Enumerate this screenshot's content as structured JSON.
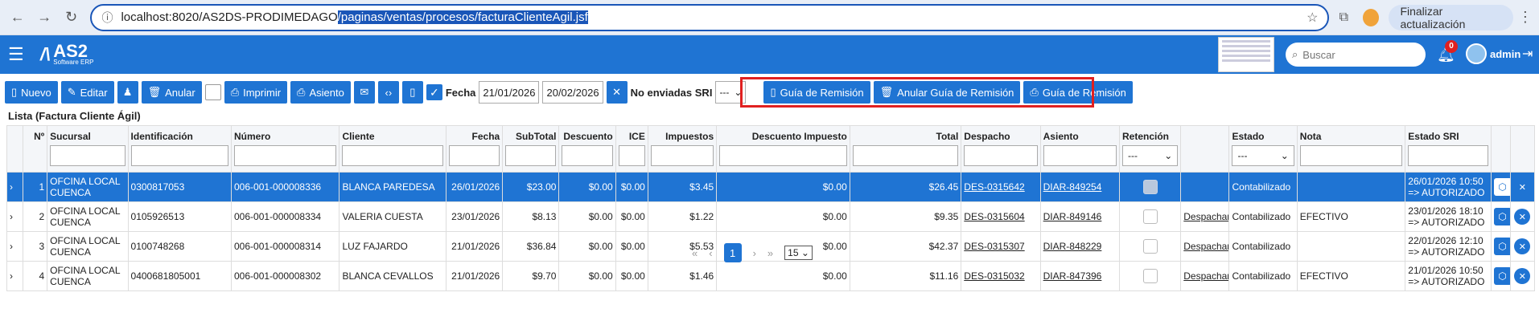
{
  "browser": {
    "url_prefix": "localhost:8020/AS2DS-PRODIMEDAGO",
    "url_selected": "/paginas/ventas/procesos/facturaClienteAgil.jsf",
    "update_label": "Finalizar actualización"
  },
  "header": {
    "logo_mark": "/\\",
    "logo_name": "AS2",
    "logo_sub": "Software ERP",
    "search_placeholder": "Buscar",
    "notif_count": "0",
    "user": "admin"
  },
  "toolbar": {
    "nuevo": "Nuevo",
    "editar": "Editar",
    "anular": "Anular",
    "imprimir": "Imprimir",
    "asiento": "Asiento",
    "fecha_label": "Fecha",
    "fecha_desde": "21/01/2026",
    "fecha_hasta": "20/02/2026",
    "no_enviadas_label": "No enviadas SRI",
    "no_enviadas_value": "---",
    "guia1": "Guía de Remisión",
    "anular_guia": "Anular Guía de Remisión",
    "guia2": "Guía de Remisión"
  },
  "list": {
    "title": "Lista (Factura Cliente Ágil)",
    "columns": [
      "Nº",
      "Sucursal",
      "Identificación",
      "Número",
      "Cliente",
      "Fecha",
      "SubTotal",
      "Descuento",
      "ICE",
      "Impuestos",
      "Descuento Impuesto",
      "Total",
      "Despacho",
      "Asiento",
      "Retención",
      "",
      "Estado",
      "Nota",
      "Estado SRI"
    ],
    "filter_select_value": "---",
    "despachar_label": "Despachar",
    "rows": [
      {
        "n": "1",
        "sucursal": "OFCINA LOCAL CUENCA",
        "id": "0300817053",
        "numero": "006-001-000008336",
        "cliente": "BLANCA PAREDESA",
        "fecha": "26/01/2026",
        "subtotal": "$23.00",
        "descuento": "$0.00",
        "ice": "$0.00",
        "impuestos": "$3.45",
        "desc_imp": "$0.00",
        "total": "$26.45",
        "despacho": "DES-0315642",
        "asiento": "DIAR-849254",
        "estado": "Contabilizado",
        "nota": "",
        "sri1": "26/01/2026 10:50",
        "sri2": "=> AUTORIZADO"
      },
      {
        "n": "2",
        "sucursal": "OFCINA LOCAL CUENCA",
        "id": "0105926513",
        "numero": "006-001-000008334",
        "cliente": "VALERIA CUESTA",
        "fecha": "23/01/2026",
        "subtotal": "$8.13",
        "descuento": "$0.00",
        "ice": "$0.00",
        "impuestos": "$1.22",
        "desc_imp": "$0.00",
        "total": "$9.35",
        "despacho": "DES-0315604",
        "asiento": "DIAR-849146",
        "estado": "Contabilizado",
        "nota": "EFECTIVO",
        "sri1": "23/01/2026 18:10",
        "sri2": "=> AUTORIZADO"
      },
      {
        "n": "3",
        "sucursal": "OFCINA LOCAL CUENCA",
        "id": "0100748268",
        "numero": "006-001-000008314",
        "cliente": "LUZ FAJARDO",
        "fecha": "21/01/2026",
        "subtotal": "$36.84",
        "descuento": "$0.00",
        "ice": "$0.00",
        "impuestos": "$5.53",
        "desc_imp": "$0.00",
        "total": "$42.37",
        "despacho": "DES-0315307",
        "asiento": "DIAR-848229",
        "estado": "Contabilizado",
        "nota": "",
        "sri1": "22/01/2026 12:10",
        "sri2": "=> AUTORIZADO"
      },
      {
        "n": "4",
        "sucursal": "OFCINA LOCAL CUENCA",
        "id": "0400681805001",
        "numero": "006-001-000008302",
        "cliente": "BLANCA CEVALLOS",
        "fecha": "21/01/2026",
        "subtotal": "$9.70",
        "descuento": "$0.00",
        "ice": "$0.00",
        "impuestos": "$1.46",
        "desc_imp": "$0.00",
        "total": "$11.16",
        "despacho": "DES-0315032",
        "asiento": "DIAR-847396",
        "estado": "Contabilizado",
        "nota": "EFECTIVO",
        "sri1": "21/01/2026 10:50",
        "sri2": "=> AUTORIZADO"
      }
    ]
  },
  "pager": {
    "first": "«",
    "prev": "‹",
    "current": "1",
    "next": "›",
    "last": "»",
    "page_size": "15"
  }
}
